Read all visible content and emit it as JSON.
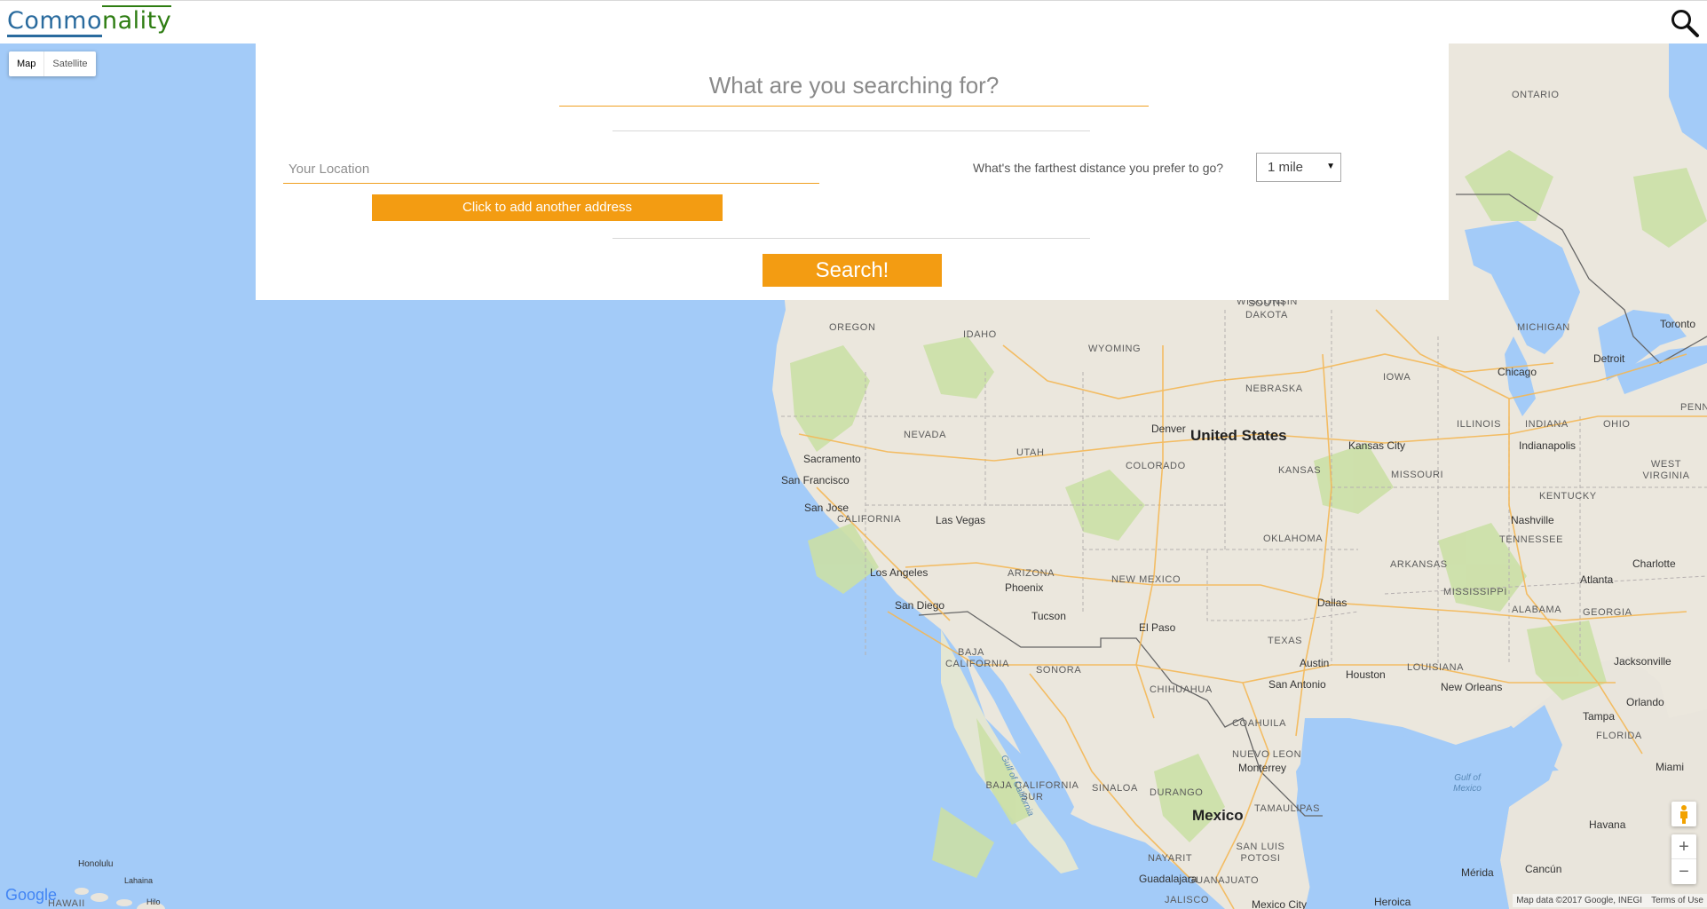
{
  "header": {
    "logo_part_a": "Commo",
    "logo_part_b": "nality"
  },
  "map_type": {
    "map_label": "Map",
    "satellite_label": "Satellite"
  },
  "search_panel": {
    "main_placeholder": "What are you searching for?",
    "location_placeholder": "Your Location",
    "distance_question": "What's the farthest distance you prefer to go?",
    "distance_value": "1 mile",
    "add_address_label": "Click to add another address",
    "search_label": "Search!"
  },
  "map_labels": {
    "states": [
      "ONTARIO",
      "WISCONSIN",
      "SOUTH DAKOTA",
      "MICHIGAN",
      "OREGON",
      "IDAHO",
      "WYOMING",
      "NEBRASKA",
      "IOWA",
      "NEVADA",
      "UTAH",
      "COLORADO",
      "KANSAS",
      "MISSOURI",
      "ILLINOIS",
      "INDIANA",
      "OHIO",
      "PENN",
      "WEST VIRGINIA",
      "KENTUCKY",
      "CALIFORNIA",
      "ARIZONA",
      "NEW MEXICO",
      "OKLAHOMA",
      "ARKANSAS",
      "TENNESSEE",
      "MISSISSIPPI",
      "ALABAMA",
      "GEORGIA",
      "TEXAS",
      "LOUISIANA",
      "FLORIDA",
      "BAJA CALIFORNIA",
      "SONORA",
      "CHIHUAHUA",
      "COAHUILA",
      "NUEVO LEON",
      "BAJA CALIFORNIA SUR",
      "SINALOA",
      "DURANGO",
      "TAMAULIPAS",
      "SAN LUIS POTOSI",
      "NAYARIT",
      "GUANAJUATO",
      "JALISCO",
      "HAWAII"
    ],
    "cities": [
      "Toronto",
      "Detroit",
      "Chicago",
      "Denver",
      "Kansas City",
      "Indianapolis",
      "Sacramento",
      "San Francisco",
      "San Jose",
      "Las Vegas",
      "Los Angeles",
      "Phoenix",
      "San Diego",
      "Tucson",
      "El Paso",
      "Dallas",
      "Nashville",
      "Charlotte",
      "Atlanta",
      "Austin",
      "Houston",
      "San Antonio",
      "New Orleans",
      "Jacksonville",
      "Orlando",
      "Tampa",
      "Miami",
      "Monterrey",
      "Havana",
      "Mérida",
      "Cancún",
      "Heroica",
      "Mexico City",
      "Guadalajara",
      "Honolulu",
      "Lahaina",
      "Hilo"
    ],
    "countries": [
      "United States",
      "Mexico"
    ],
    "waters": [
      "Gulf of California",
      "Gulf of Mexico"
    ]
  },
  "footer": {
    "google_logo": "Google",
    "map_data": "Map data ©2017 Google, INEGI",
    "terms": "Terms of Use"
  },
  "zoom": {
    "in": "+",
    "out": "−"
  }
}
